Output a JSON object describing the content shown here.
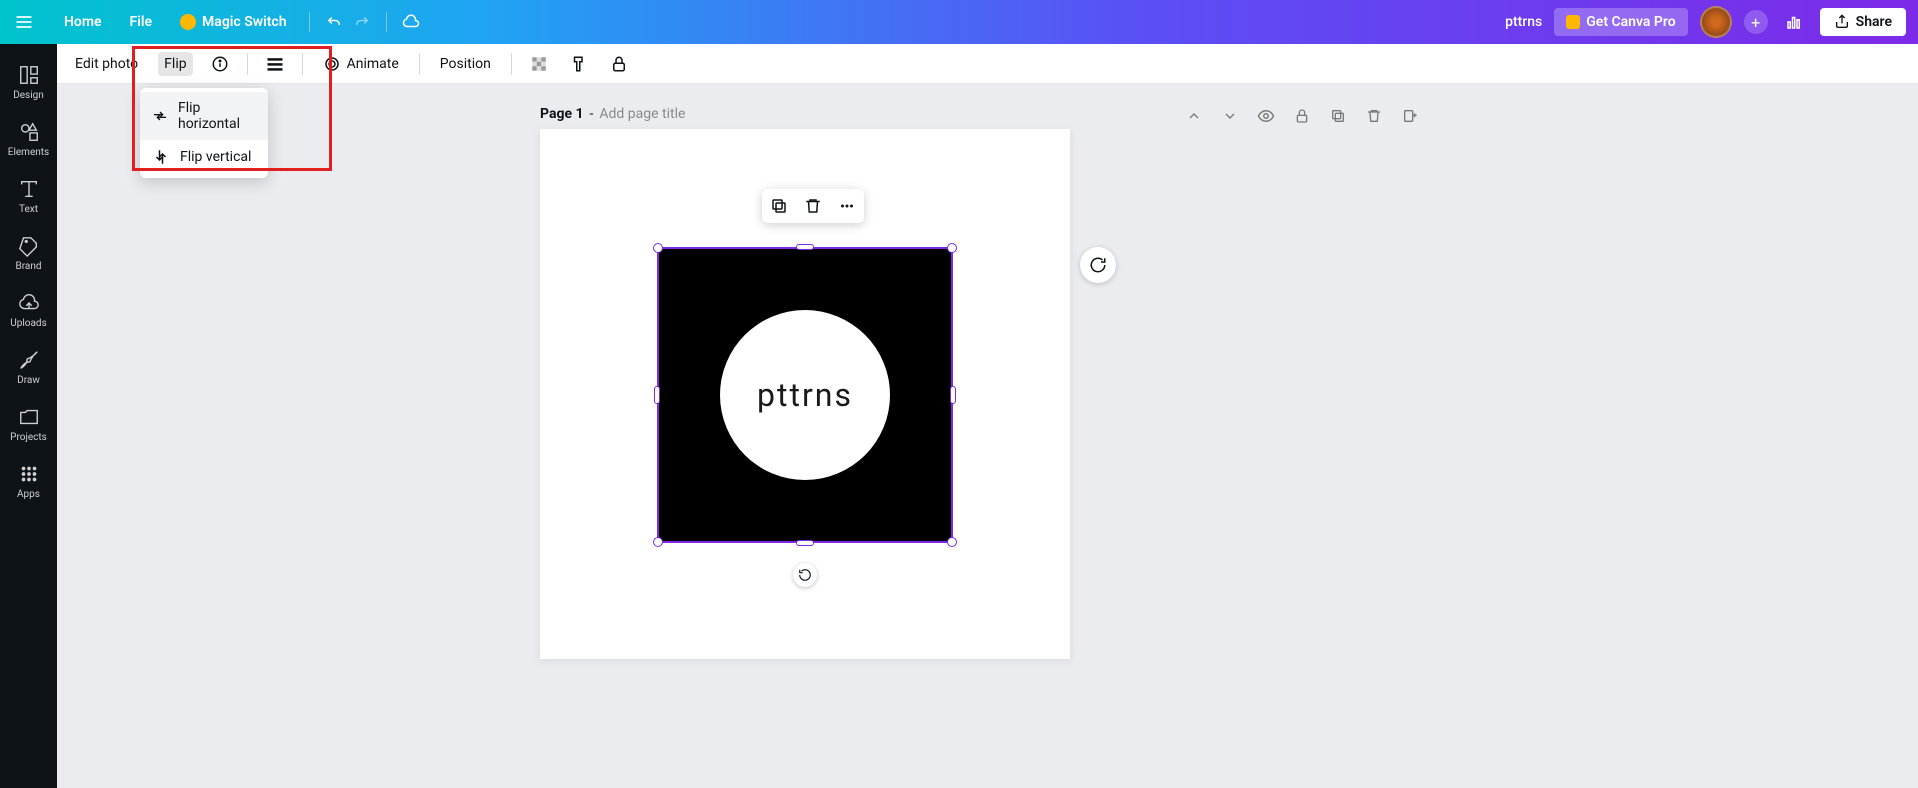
{
  "header": {
    "home": "Home",
    "file": "File",
    "magic_switch": "Magic Switch",
    "doc_title": "pttrns",
    "get_pro": "Get Canva Pro",
    "share": "Share"
  },
  "sidebar": {
    "items": [
      {
        "label": "Design"
      },
      {
        "label": "Elements"
      },
      {
        "label": "Text"
      },
      {
        "label": "Brand"
      },
      {
        "label": "Uploads"
      },
      {
        "label": "Draw"
      },
      {
        "label": "Projects"
      },
      {
        "label": "Apps"
      }
    ]
  },
  "ctx": {
    "edit_photo": "Edit photo",
    "flip": "Flip",
    "animate": "Animate",
    "position": "Position"
  },
  "flip_menu": {
    "horizontal": "Flip horizontal",
    "vertical": "Flip vertical"
  },
  "page": {
    "label": "Page 1",
    "separator": " - ",
    "title_placeholder": "Add page title"
  },
  "element": {
    "logo_text": "pttrns"
  }
}
